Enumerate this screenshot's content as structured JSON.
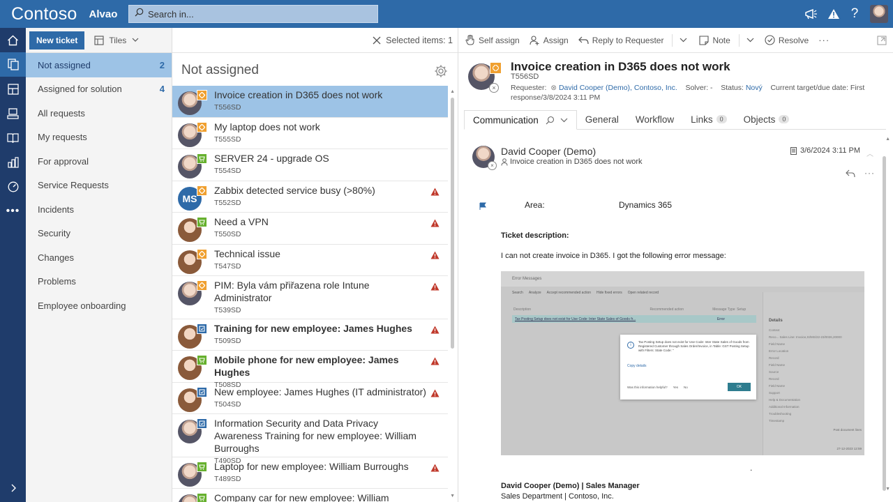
{
  "app": {
    "brand": "Contoso",
    "product": "Alvao"
  },
  "search": {
    "placeholder": "Search in..."
  },
  "colors": {
    "topbar": "#2e6aa8",
    "rail": "#1f3c6b",
    "selected": "#9dc3e6",
    "warning": "#c0392b",
    "link": "#2e6aa8"
  },
  "nav": {
    "new_ticket": "New ticket",
    "tiles": "Tiles",
    "items": [
      {
        "label": "Not assigned",
        "count": "2"
      },
      {
        "label": "Assigned for solution",
        "count": "4"
      },
      {
        "label": "All requests",
        "count": ""
      },
      {
        "label": "My requests",
        "count": ""
      },
      {
        "label": "For approval",
        "count": ""
      },
      {
        "label": "Service Requests",
        "count": ""
      },
      {
        "label": "Incidents",
        "count": ""
      },
      {
        "label": "Security",
        "count": ""
      },
      {
        "label": "Changes",
        "count": ""
      },
      {
        "label": "Problems",
        "count": ""
      },
      {
        "label": "Employee onboarding",
        "count": ""
      }
    ]
  },
  "list": {
    "selected_label": "Selected items: 1",
    "title": "Not assigned",
    "tickets": [
      {
        "title": "Invoice creation in D365 does not work",
        "id": "T556SD",
        "avatar": "male",
        "badge": "orange",
        "warning": false,
        "bold": false
      },
      {
        "title": "My laptop does not work",
        "id": "T555SD",
        "avatar": "male",
        "badge": "orange",
        "warning": false,
        "bold": false
      },
      {
        "title": "SERVER 24 - upgrade OS",
        "id": "T554SD",
        "avatar": "male",
        "badge": "green",
        "warning": false,
        "bold": false
      },
      {
        "title": "Zabbix detected service busy (>80%)",
        "id": "T552SD",
        "avatar": "ms",
        "avatar_text": "MS",
        "badge": "orange",
        "warning": true,
        "bold": false
      },
      {
        "title": "Need a VPN",
        "id": "T550SD",
        "avatar": "female",
        "badge": "green",
        "warning": true,
        "bold": false
      },
      {
        "title": "Technical issue",
        "id": "T547SD",
        "avatar": "female",
        "badge": "orange",
        "warning": true,
        "bold": false
      },
      {
        "title": "PIM: Byla vám přiřazena role Intune Administrator",
        "id": "T539SD",
        "avatar": "male",
        "badge": "orange",
        "warning": true,
        "bold": false
      },
      {
        "title": "Training for new employee: James Hughes",
        "id": "T509SD",
        "avatar": "female",
        "badge": "blue",
        "warning": true,
        "bold": true
      },
      {
        "title": "Mobile phone for new employee: James Hughes",
        "id": "T508SD",
        "avatar": "female",
        "badge": "green",
        "warning": true,
        "bold": true
      },
      {
        "title": "New employee: James Hughes (IT administrator)",
        "id": "T504SD",
        "avatar": "female",
        "badge": "blue",
        "warning": true,
        "bold": false
      },
      {
        "title": "Information Security and Data Privacy Awareness Training for new employee: William Burroughs",
        "id": "T490SD",
        "avatar": "male",
        "badge": "blue",
        "warning": false,
        "bold": false
      },
      {
        "title": "Laptop for new employee: William Burroughs",
        "id": "T489SD",
        "avatar": "male",
        "badge": "green",
        "warning": true,
        "bold": false
      },
      {
        "title": "Company car for new employee: William Burroughs",
        "id": "",
        "avatar": "male",
        "badge": "green",
        "warning": false,
        "bold": false
      }
    ]
  },
  "toolbar": {
    "self_assign": "Self assign",
    "assign": "Assign",
    "reply": "Reply to Requester",
    "note": "Note",
    "resolve": "Resolve"
  },
  "detail": {
    "title": "Invoice creation in D365 does not work",
    "id": "T556SD",
    "requester_label": "Requester:",
    "requester": "David Cooper (Demo), Contoso, Inc.",
    "solver_label": "Solver:",
    "solver": "-",
    "status_label": "Status:",
    "status": "Nový",
    "due_label": "Current target/due date:",
    "due": "First response/3/8/2024 3:11 PM",
    "tabs": [
      {
        "label": "Communication",
        "count": ""
      },
      {
        "label": "General",
        "count": ""
      },
      {
        "label": "Workflow",
        "count": ""
      },
      {
        "label": "Links",
        "count": "0"
      },
      {
        "label": "Objects",
        "count": "0"
      }
    ],
    "message": {
      "author": "David Cooper (Demo)",
      "subject": "Invoice creation in D365 does not work",
      "date": "3/6/2024 3:11 PM",
      "area_label": "Area:",
      "area_value": "Dynamics 365",
      "desc_heading": "Ticket description:",
      "desc_text": "I can not create invoice in D365. I got the following error message:",
      "signature": "David Cooper (Demo) | Sales Manager",
      "signature2": "Sales Department | Contoso, Inc."
    },
    "screenshot": {
      "header": "Error Messages",
      "toolbar": [
        "Search",
        "Analyze",
        "Accept recommended action",
        "Hide fixed errors",
        "Open related record"
      ],
      "columns": [
        "Description",
        "Recommended action",
        "Message Type",
        "Setup"
      ],
      "row_text": "Tax Posting Setup does not exist for Use Code: Inter State Sales of Goods fr...",
      "row_type": "Error",
      "dialog_text": "Tax Posting Setup does not exist for Use Code: Inter State Sales of Goods from Registered Customer through Sales Order/Invoice, in Table: GST Posting Setup with Filters: State Code: ''",
      "copy_details": "Copy details",
      "helpful": "Was this information helpful?",
      "yes": "Yes",
      "no": "No",
      "ok": "OK",
      "details_title": "Details",
      "details": [
        "Context",
        "Reco... Sales Line: Invoice,SI/MS/22-23/0026,20000",
        "Field Name",
        "Error Location",
        "Record",
        "Field Name",
        "Source",
        "Record",
        "Field Name",
        "Support",
        "Help & Documentation",
        "Additional Information",
        "Troubleshooting",
        "Timestamp"
      ],
      "post_doc": "Post document lines",
      "timestamp": "27-12-2023 12:59"
    }
  }
}
